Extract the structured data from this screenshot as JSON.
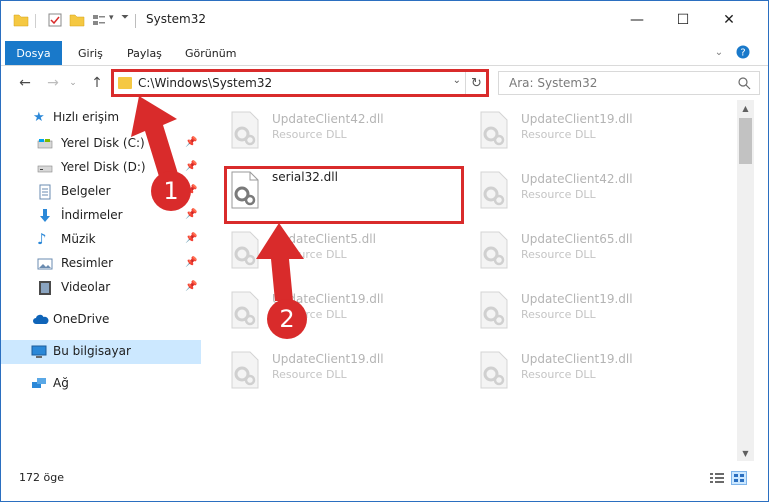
{
  "window": {
    "title": "System32",
    "controls": {
      "minimize": "—",
      "maximize": "☐",
      "close": "✕"
    }
  },
  "ribbon": {
    "tabs": [
      "Dosya",
      "Giriş",
      "Paylaş",
      "Görünüm"
    ],
    "expand_icon": "chevron-down-icon",
    "help_icon": "help-icon"
  },
  "address": {
    "path": "C:\\Windows\\System32",
    "refresh_icon": "refresh-icon",
    "search_placeholder": "Ara: System32"
  },
  "nav": {
    "quick_access": "Hızlı erişim",
    "items": [
      {
        "label": "Yerel Disk (C:)",
        "icon": "drive-icon",
        "pinned": true
      },
      {
        "label": "Yerel Disk (D:)",
        "icon": "drive-icon",
        "pinned": true
      },
      {
        "label": "Belgeler",
        "icon": "documents-icon",
        "pinned": true
      },
      {
        "label": "İndirmeler",
        "icon": "downloads-icon",
        "pinned": true
      },
      {
        "label": "Müzik",
        "icon": "music-icon",
        "pinned": true
      },
      {
        "label": "Resimler",
        "icon": "pictures-icon",
        "pinned": true
      },
      {
        "label": "Videolar",
        "icon": "videos-icon",
        "pinned": true
      }
    ],
    "onedrive": "OneDrive",
    "this_pc": "Bu bilgisayar",
    "network": "Ağ"
  },
  "files": {
    "left_column": [
      {
        "name": "UpdateClient42.dll",
        "type": "Resource DLL"
      },
      {
        "name": "serial32.dll",
        "type": ""
      },
      {
        "name": "UpdateClient5.dll",
        "type": "Resource DLL"
      },
      {
        "name": "UpdateClient19.dll",
        "type": "Resource DLL"
      },
      {
        "name": "UpdateClient19.dll",
        "type": "Resource DLL"
      }
    ],
    "right_column": [
      {
        "name": "UpdateClient19.dll",
        "type": "Resource DLL"
      },
      {
        "name": "UpdateClient42.dll",
        "type": "Resource DLL"
      },
      {
        "name": "UpdateClient65.dll",
        "type": "Resource DLL"
      },
      {
        "name": "UpdateClient19.dll",
        "type": "Resource DLL"
      },
      {
        "name": "UpdateClient19.dll",
        "type": "Resource DLL"
      }
    ]
  },
  "status": {
    "item_count": "172 öge"
  },
  "annotations": {
    "marker1": "1",
    "marker2": "2",
    "color": "#d92b2b"
  },
  "colors": {
    "accent": "#1979ca",
    "selected_nav": "#cce8ff",
    "annotation": "#d92b2b"
  }
}
